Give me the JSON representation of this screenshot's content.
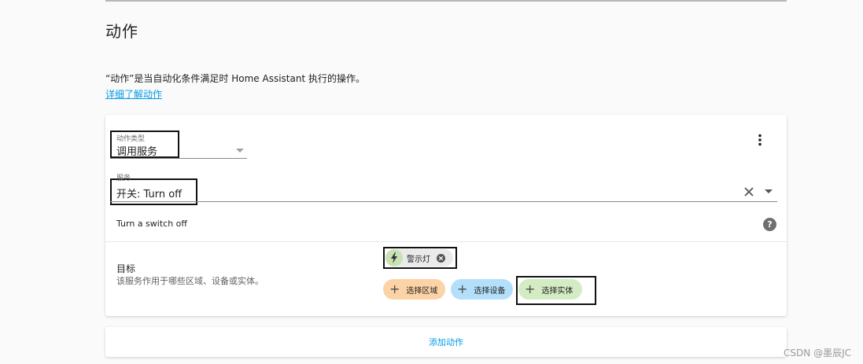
{
  "section": {
    "title": "动作",
    "description": "“动作”是当自动化条件满足时 Home Assistant 执行的操作。",
    "learn_more": "详细了解动作"
  },
  "action_card": {
    "action_type": {
      "label": "动作类型",
      "value": "调用服务"
    },
    "service": {
      "label": "服务",
      "value": "开关: Turn off"
    },
    "service_description": "Turn a switch off",
    "target": {
      "title": "目标",
      "description": "该服务作用于哪些区域、设备或实体。",
      "selected_entity": "警示灯",
      "chips": {
        "area": "选择区域",
        "device": "选择设备",
        "entity": "选择实体"
      }
    }
  },
  "add_action_label": "添加动作",
  "watermark": "CSDN @墨辰JC",
  "colors": {
    "link": "#039be5",
    "chip_area": "#fbd3a6",
    "chip_device": "#b3dffa",
    "chip_entity": "#d4ecc4"
  }
}
